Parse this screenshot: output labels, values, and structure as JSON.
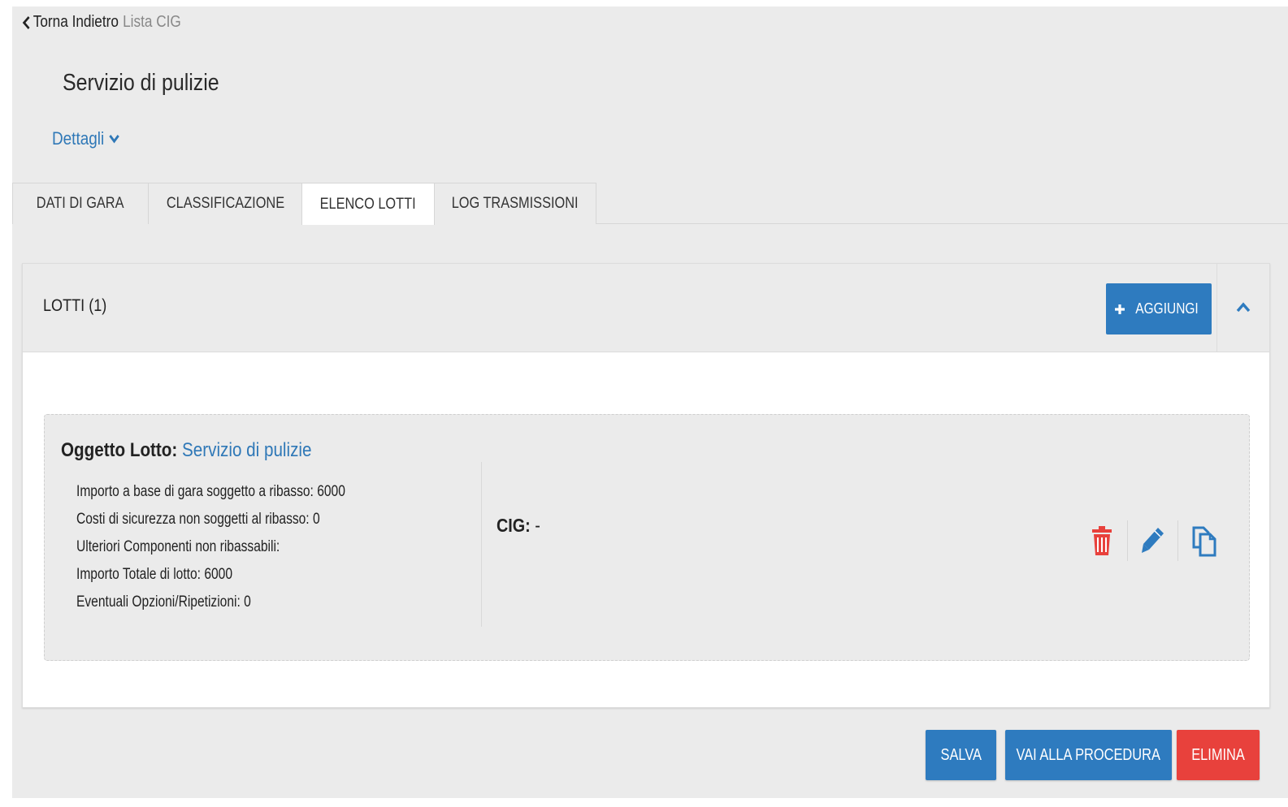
{
  "header": {
    "back_label": "Torna Indietro",
    "breadcrumb": "Lista CIG",
    "title": "Servizio di pulizie",
    "details_label": "Dettagli"
  },
  "tabs": [
    {
      "label": "DATI DI GARA",
      "active": false
    },
    {
      "label": "CLASSIFICAZIONE",
      "active": false
    },
    {
      "label": "ELENCO LOTTI",
      "active": true
    },
    {
      "label": "LOG TRASMISSIONI",
      "active": false
    }
  ],
  "panel": {
    "title": "LOTTI (1)",
    "add_label": "AGGIUNGI"
  },
  "lot": {
    "subject_key": "Oggetto Lotto:",
    "subject_value": "Servizio di pulizie",
    "details": [
      "Importo a base di gara soggetto a ribasso: 6000",
      "Costi di sicurezza non soggetti al ribasso: 0",
      "Ulteriori Componenti non ribassabili:",
      "Importo Totale di lotto: 6000",
      "Eventuali Opzioni/Ripetizioni: 0"
    ],
    "cig_key": "CIG:",
    "cig_value": "-"
  },
  "footer": {
    "save_label": "SALVA",
    "procedure_label": "VAI ALLA PROCEDURA",
    "delete_label": "ELIMINA"
  },
  "icons": {
    "back": "chevron-left-icon",
    "details": "chevron-down-icon",
    "add": "plus-icon",
    "collapse": "chevron-up-icon",
    "delete": "trash-icon",
    "edit": "pencil-icon",
    "copy": "copy-icon"
  },
  "colors": {
    "primary": "#2e7bbf",
    "danger": "#e8413c",
    "link": "#2f78b7",
    "background": "#ebebeb"
  }
}
